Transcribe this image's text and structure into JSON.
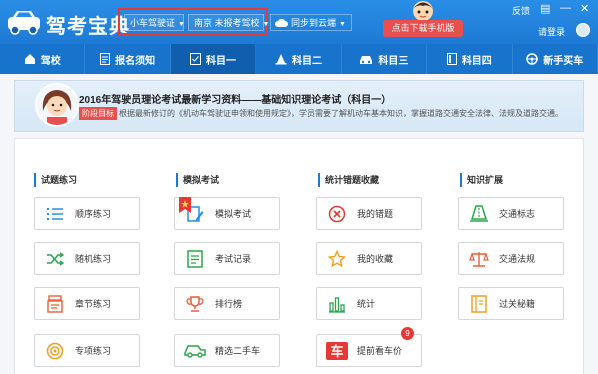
{
  "app": {
    "name": "驾考宝典",
    "license_type": "小车驾驶证",
    "location": "南京 未报考驾校",
    "sync_label": "同步到云端",
    "mobile_button": "点击下载手机版",
    "feedback": "反馈",
    "login": "请登录"
  },
  "nav": {
    "items": [
      {
        "label": "驾校",
        "icon": "home-icon"
      },
      {
        "label": "报名须知",
        "icon": "document-icon"
      },
      {
        "label": "科目一",
        "icon": "checklist-icon",
        "active": true
      },
      {
        "label": "科目二",
        "icon": "cone-icon"
      },
      {
        "label": "科目三",
        "icon": "car-icon"
      },
      {
        "label": "科目四",
        "icon": "book-icon"
      },
      {
        "label": "新手买车",
        "icon": "steering-wheel-icon"
      }
    ]
  },
  "banner": {
    "title": "2016年驾驶员理论考试最新学习资料——基础知识理论考试（科目一）",
    "tag": "阶段目标",
    "desc": "根据最新修订的《机动车驾驶证申领和使用规定》，学员需要了解机动车基本知识，掌握道路交通安全法律、法规及道路交通。"
  },
  "sections": [
    {
      "title": "试题练习",
      "buttons": [
        {
          "label": "顺序练习",
          "icon": "list-icon"
        },
        {
          "label": "随机练习",
          "icon": "shuffle-icon"
        },
        {
          "label": "章节练习",
          "icon": "chapter-icon"
        },
        {
          "label": "专项练习",
          "icon": "target-icon"
        }
      ]
    },
    {
      "title": "模拟考试",
      "buttons": [
        {
          "label": "模拟考试",
          "icon": "exam-edit-icon"
        },
        {
          "label": "考试记录",
          "icon": "record-icon"
        },
        {
          "label": "排行榜",
          "icon": "trophy-icon"
        },
        {
          "label": "精选二手车",
          "icon": "used-car-icon"
        }
      ]
    },
    {
      "title": "统计错题收藏",
      "buttons": [
        {
          "label": "我的错题",
          "icon": "wrong-icon"
        },
        {
          "label": "我的收藏",
          "icon": "star-icon"
        },
        {
          "label": "统计",
          "icon": "bar-chart-icon"
        },
        {
          "label": "提前看车价",
          "icon": "car-price-icon",
          "badge": "9"
        }
      ]
    },
    {
      "title": "知识扩展",
      "buttons": [
        {
          "label": "交通标志",
          "icon": "traffic-sign-icon"
        },
        {
          "label": "交通法规",
          "icon": "law-scale-icon"
        },
        {
          "label": "过关秘籍",
          "icon": "secret-book-icon"
        }
      ]
    }
  ],
  "colors": {
    "titlebar": "#2a8ee6",
    "navbar": "#1873cc",
    "accent_red": "#e94f4f",
    "highlight_border": "#e53935"
  }
}
